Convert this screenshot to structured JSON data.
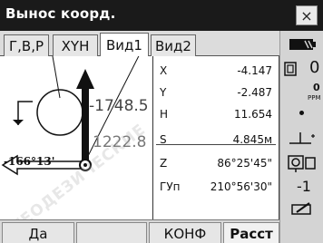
{
  "window": {
    "title": "Вынос коорд.",
    "close_symbol": "×"
  },
  "tabs": [
    {
      "label": "Г,В,Р",
      "active": false
    },
    {
      "label": "XYH",
      "active": false
    },
    {
      "label": "Вид1",
      "active": true
    },
    {
      "label": "Вид2",
      "active": false
    }
  ],
  "graphic": {
    "distance_top": "-1748.5",
    "distance_bottom": "1222.8",
    "angle": "-166°13'"
  },
  "measurements": [
    {
      "label": "X",
      "value": "-4.147"
    },
    {
      "label": "Y",
      "value": "-2.487"
    },
    {
      "label": "H",
      "value": "11.654"
    },
    {
      "label": "S",
      "value": "4.845м"
    },
    {
      "label": "Z",
      "value": "86°25'45\""
    },
    {
      "label": "ГУп",
      "value": "210°56'30\""
    }
  ],
  "sidebar": {
    "battery_icon": "battery-icon",
    "prism_constant": "0",
    "ppm_value": "0",
    "ppm_label": "PPM",
    "target_mode": "-1"
  },
  "softkeys": [
    {
      "label": "Да",
      "selected": false
    },
    {
      "label": "",
      "selected": false
    },
    {
      "label": "КОНФ",
      "selected": false
    },
    {
      "label": "Расст",
      "selected": true
    }
  ],
  "watermark": "ГЕОДЕЗИЧЕСКИЕ",
  "colors": {
    "titlebar": "#1a1a1a",
    "panel": "#ffffff",
    "chrome": "#cfcfcf"
  }
}
